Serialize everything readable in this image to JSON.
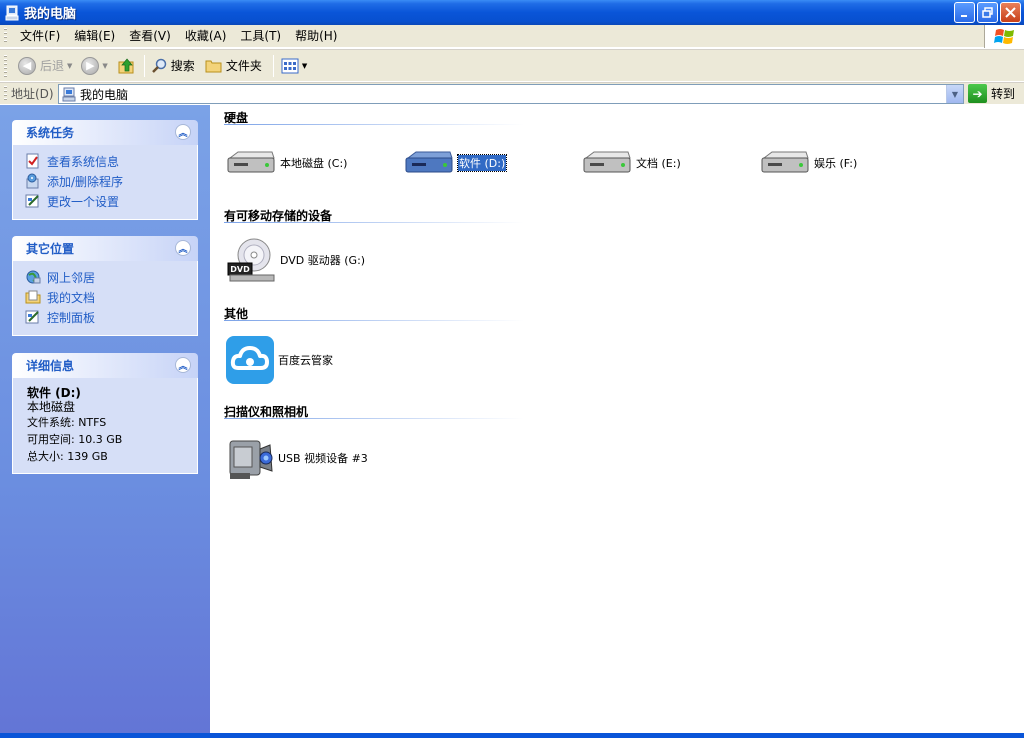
{
  "window": {
    "title": "我的电脑",
    "icon": "computer-icon"
  },
  "menu": [
    "文件(F)",
    "编辑(E)",
    "查看(V)",
    "收藏(A)",
    "工具(T)",
    "帮助(H)"
  ],
  "toolbar": {
    "back": "后退",
    "search": "搜索",
    "folders": "文件夹"
  },
  "address": {
    "label": "地址(D)",
    "value": "我的电脑",
    "go": "转到"
  },
  "sidebar": {
    "system_tasks": {
      "title": "系统任务",
      "items": [
        "查看系统信息",
        "添加/删除程序",
        "更改一个设置"
      ]
    },
    "other_places": {
      "title": "其它位置",
      "items": [
        "网上邻居",
        "我的文档",
        "控制面板"
      ]
    },
    "details": {
      "title": "详细信息",
      "name": "软件 (D:)",
      "type": "本地磁盘",
      "filesystem": "文件系统: NTFS",
      "free": "可用空间: 10.3 GB",
      "total": "总大小: 139 GB"
    }
  },
  "content": {
    "groups": [
      {
        "title": "硬盘",
        "items": [
          "本地磁盘 (C:)",
          "软件 (D:)",
          "文档 (E:)",
          "娱乐 (F:)"
        ]
      },
      {
        "title": "有可移动存储的设备",
        "items": [
          "DVD 驱动器 (G:)"
        ]
      },
      {
        "title": "其他",
        "items": [
          "百度云管家"
        ]
      },
      {
        "title": "扫描仪和照相机",
        "items": [
          "USB 视频设备 #3"
        ]
      }
    ],
    "selected": "软件 (D:)"
  },
  "colors": {
    "titlebar": "#0a55d8",
    "sidebar": "#7ba2e7",
    "link": "#215dc6",
    "selection": "#316ac5"
  }
}
